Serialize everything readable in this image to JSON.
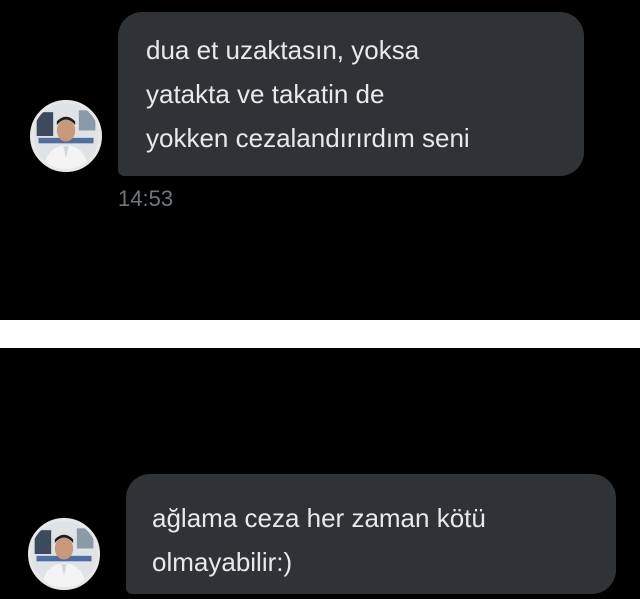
{
  "conversation": {
    "messages": [
      {
        "lines": [
          "dua et uzaktasın, yoksa",
          "yatakta ve takatin de",
          "yokken cezalandırırdım seni"
        ],
        "time": "14:53"
      },
      {
        "lines": [
          "ağlama ceza her zaman kötü",
          "olmayabilir:)"
        ]
      }
    ]
  },
  "theme": {
    "background": "#000000",
    "bubble": "#2f3336",
    "text": "#e7e9ea",
    "timestamp": "#71767b"
  },
  "icons": {
    "avatar": "user-avatar-photo"
  }
}
